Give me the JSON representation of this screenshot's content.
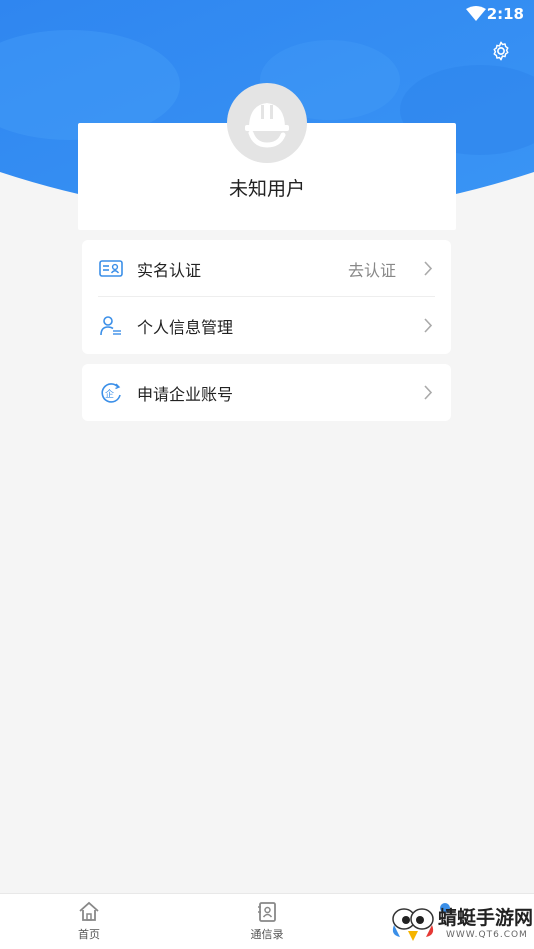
{
  "status_bar": {
    "time": "2:18"
  },
  "profile": {
    "username": "未知用户"
  },
  "menu_group_1": [
    {
      "label": "实名认证",
      "value": "去认证",
      "icon": "id-card-icon"
    },
    {
      "label": "个人信息管理",
      "value": "",
      "icon": "user-list-icon"
    }
  ],
  "menu_group_2": [
    {
      "label": "申请企业账号",
      "icon": "enterprise-icon"
    }
  ],
  "tabbar": [
    {
      "label": "首页",
      "icon": "home-icon"
    },
    {
      "label": "通信录",
      "icon": "contacts-icon"
    },
    {
      "label": "",
      "icon": "profile-icon"
    }
  ],
  "watermark": {
    "text": "蜻蜓手游网",
    "url": "WWW.QT6.COM"
  },
  "colors": {
    "primary": "#3b8fe8",
    "background": "#f5f5f5"
  }
}
